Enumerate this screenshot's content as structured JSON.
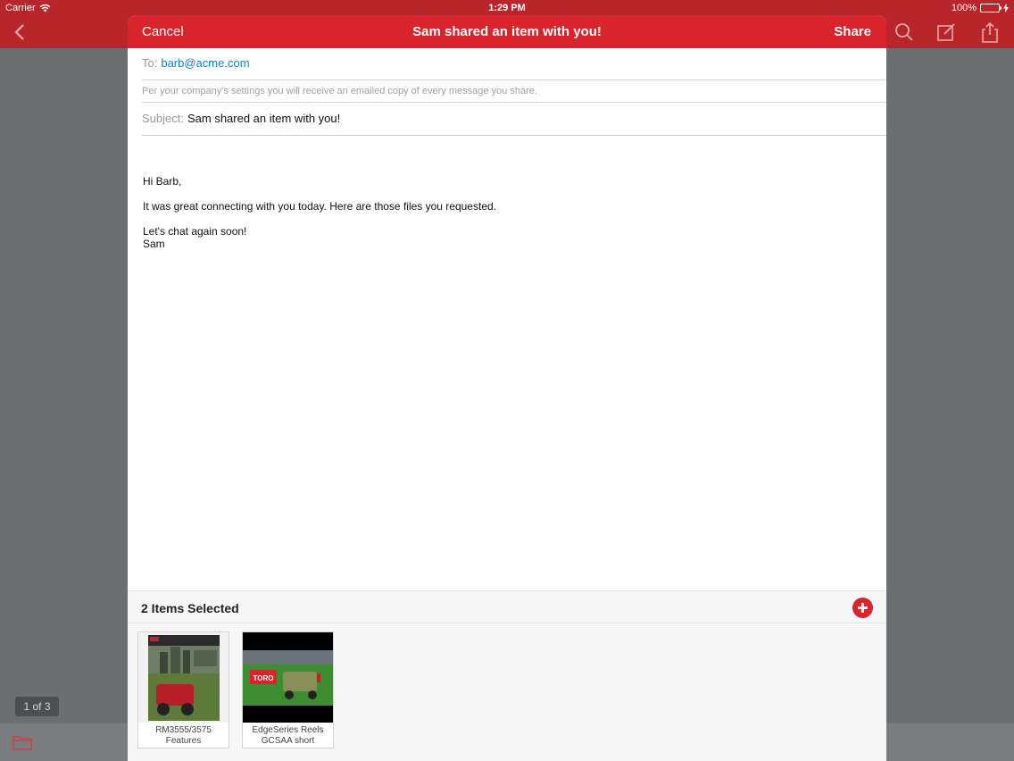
{
  "status_bar": {
    "carrier": "Carrier",
    "time": "1:29 PM",
    "battery": "100%"
  },
  "background": {
    "page_indicator": "1 of 3"
  },
  "share_sheet": {
    "cancel_label": "Cancel",
    "title": "Sam  shared an item with you!",
    "share_label": "Share",
    "to_label": "To:",
    "to_value": "barb@acme.com",
    "notice": "Per your company's settings you will receive an emailed copy of every message you share.",
    "subject_label": "Subject:",
    "subject_value": "Sam shared an item with you!",
    "body": {
      "greeting": "Hi Barb,",
      "line1": "It was great connecting with you today. Here are those files you requested.",
      "closing": "Let's chat again soon!",
      "signature": "Sam"
    },
    "items_selected": "2 Items Selected",
    "items": [
      {
        "caption_line1": "RM3555/3575",
        "caption_line2": "Features"
      },
      {
        "caption_line1": "EdgeSeries Reels",
        "caption_line2": "GCSAA short",
        "thumb_badge": "TORO"
      }
    ]
  },
  "colors": {
    "header_red": "#d9232d",
    "link_blue": "#1b7fc1",
    "battery_green": "#4cd964"
  }
}
